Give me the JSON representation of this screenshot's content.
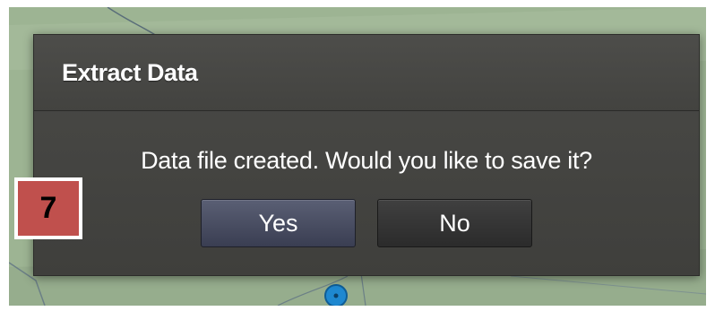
{
  "dialog": {
    "title": "Extract Data",
    "message": "Data file created. Would you like to save it?",
    "yes_label": "Yes",
    "no_label": "No"
  },
  "annotation": {
    "step_number": "7",
    "color": "#c0504d"
  },
  "colors": {
    "dialog_background": "#454542",
    "yes_button": "#4a4f63",
    "no_button": "#363636",
    "map_background": "#9fb596"
  }
}
